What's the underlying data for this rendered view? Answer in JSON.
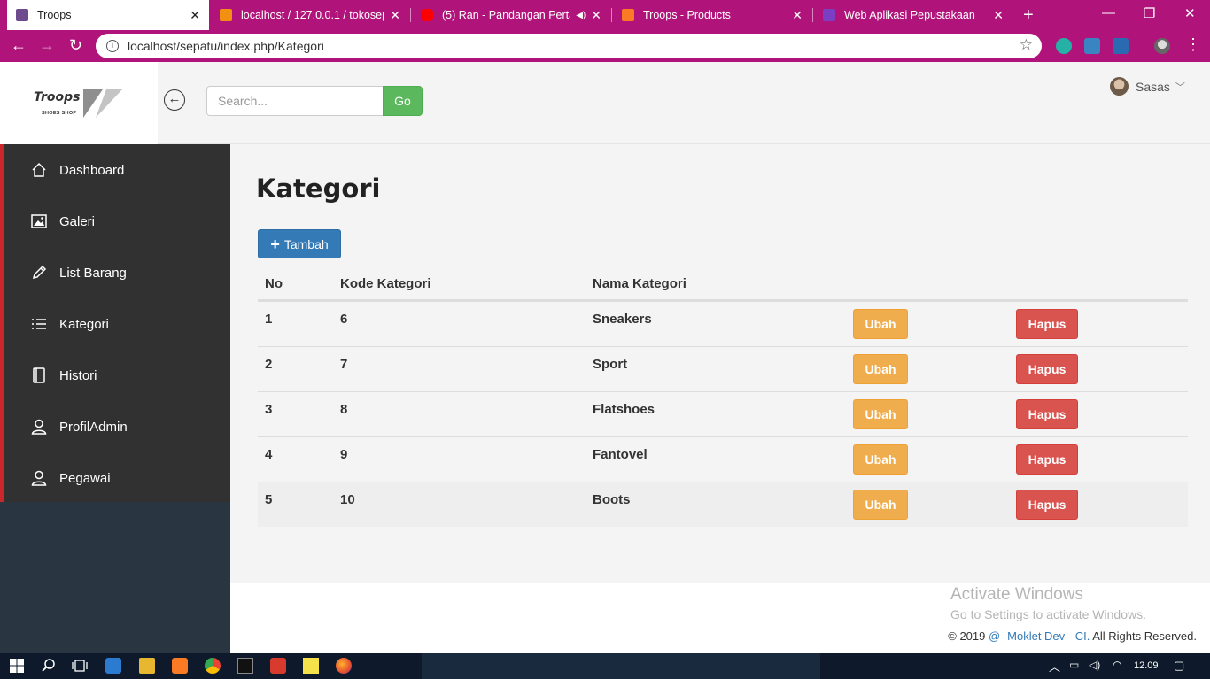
{
  "browser": {
    "tabs": [
      {
        "title": "Troops",
        "active": true
      },
      {
        "title": "localhost / 127.0.0.1 / tokosepatu",
        "active": false
      },
      {
        "title": "(5) Ran - Pandangan Pertama",
        "active": false
      },
      {
        "title": "Troops - Products",
        "active": false
      },
      {
        "title": "Web Aplikasi Pepustakaan",
        "active": false
      }
    ],
    "url": "localhost/sepatu/index.php/Kategori",
    "accent": "#b0147a"
  },
  "header": {
    "logo_text": "Troops",
    "logo_sub": "SHOES SHOP",
    "search_placeholder": "Search...",
    "go_label": "Go",
    "user_name": "Sasas"
  },
  "sidebar": {
    "items": [
      {
        "label": "Dashboard",
        "icon": "home-icon"
      },
      {
        "label": "Galeri",
        "icon": "image-icon"
      },
      {
        "label": "List Barang",
        "icon": "pencil-icon"
      },
      {
        "label": "Kategori",
        "icon": "list-icon"
      },
      {
        "label": "Histori",
        "icon": "book-icon"
      },
      {
        "label": "ProfilAdmin",
        "icon": "user-icon"
      },
      {
        "label": "Pegawai",
        "icon": "user-icon"
      }
    ]
  },
  "main": {
    "title": "Kategori",
    "add_label": "Tambah",
    "columns": [
      "No",
      "Kode Kategori",
      "Nama Kategori"
    ],
    "rows": [
      {
        "no": "1",
        "kode": "6",
        "nama": "Sneakers"
      },
      {
        "no": "2",
        "kode": "7",
        "nama": "Sport"
      },
      {
        "no": "3",
        "kode": "8",
        "nama": "Flatshoes"
      },
      {
        "no": "4",
        "kode": "9",
        "nama": "Fantovel"
      },
      {
        "no": "5",
        "kode": "10",
        "nama": "Boots"
      }
    ],
    "edit_label": "Ubah",
    "delete_label": "Hapus"
  },
  "footer": {
    "activate_title": "Activate Windows",
    "activate_sub": "Go to Settings to activate Windows.",
    "copyright_prefix": "© 2019 ",
    "copyright_link": "@- Moklet Dev - CI.",
    "copyright_suffix": " All Rights Reserved."
  },
  "taskbar": {
    "time": "12.09"
  }
}
